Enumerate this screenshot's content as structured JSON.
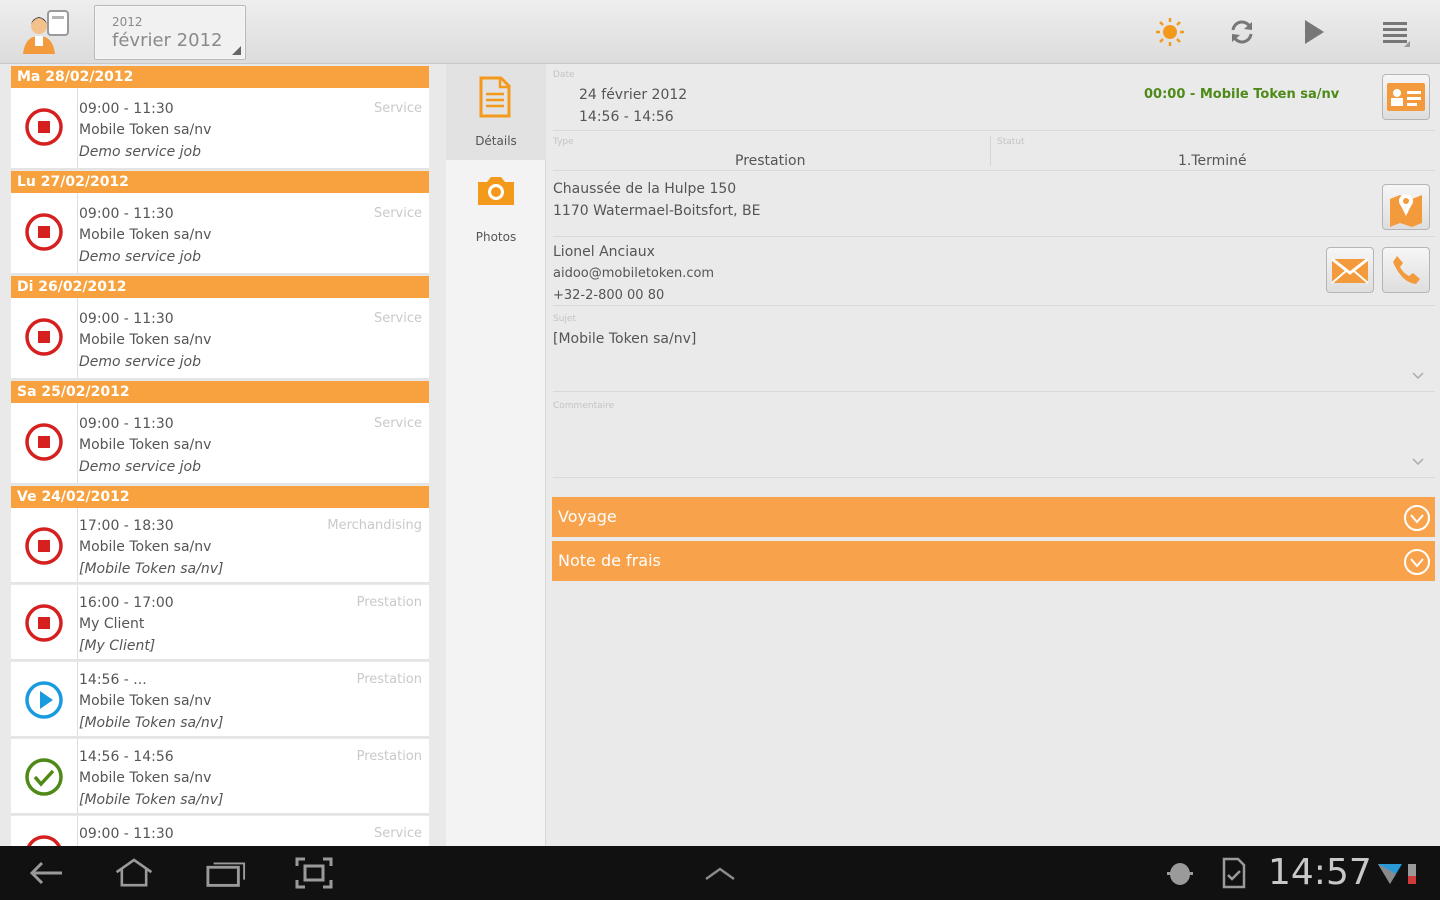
{
  "colors": {
    "accent": "#f8a23f",
    "stop": "#d62020",
    "running": "#1a9be0",
    "done": "#4f8a17"
  },
  "top_bar": {
    "month_spinner": {
      "year": "2012",
      "month": "février 2012"
    },
    "icons": [
      "sun-icon",
      "refresh-icon",
      "play-icon",
      "menu-icon"
    ]
  },
  "job_list": {
    "days": [
      {
        "header": "Ma 28/02/2012",
        "jobs": [
          {
            "status": "stopped",
            "time": "09:00 - 11:30",
            "client": "Mobile Token sa/nv",
            "desc": "Demo service job",
            "type": "Service"
          }
        ]
      },
      {
        "header": "Lu 27/02/2012",
        "jobs": [
          {
            "status": "stopped",
            "time": "09:00 - 11:30",
            "client": "Mobile Token sa/nv",
            "desc": "Demo service job",
            "type": "Service"
          }
        ]
      },
      {
        "header": "Di 26/02/2012",
        "jobs": [
          {
            "status": "stopped",
            "time": "09:00 - 11:30",
            "client": "Mobile Token sa/nv",
            "desc": "Demo service job",
            "type": "Service"
          }
        ]
      },
      {
        "header": "Sa 25/02/2012",
        "jobs": [
          {
            "status": "stopped",
            "time": "09:00 - 11:30",
            "client": "Mobile Token sa/nv",
            "desc": "Demo service job",
            "type": "Service"
          }
        ]
      },
      {
        "header": "Ve 24/02/2012",
        "jobs": [
          {
            "status": "stopped",
            "time": "17:00 - 18:30",
            "client": "Mobile Token sa/nv",
            "desc": "[Mobile Token sa/nv]",
            "type": "Merchandising"
          },
          {
            "status": "stopped",
            "time": "16:00 - 17:00",
            "client": "My Client",
            "desc": "[My Client]",
            "type": "Prestation"
          },
          {
            "status": "running",
            "time": "14:56 - ...",
            "client": "Mobile Token sa/nv",
            "desc": "[Mobile Token sa/nv]",
            "type": "Prestation"
          },
          {
            "status": "done",
            "time": "14:56 - 14:56",
            "client": "Mobile Token sa/nv",
            "desc": "[Mobile Token sa/nv]",
            "type": "Prestation"
          },
          {
            "status": "stopped",
            "time": "09:00 - 11:30",
            "client": "",
            "desc": "",
            "type": "Service"
          }
        ]
      }
    ]
  },
  "tabs": [
    {
      "label": "Détails",
      "icon": "document-icon"
    },
    {
      "label": "Photos",
      "icon": "camera-icon"
    }
  ],
  "detail": {
    "date_label": "Date",
    "date": "24 février 2012",
    "time_range": "14:56 - 14:56",
    "job_summary": "00:00 - Mobile Token sa/nv",
    "type_label": "Type",
    "type_value": "Prestation",
    "status_label": "Statut",
    "status_value": "1.Terminé",
    "address_line1": "Chaussée de la Hulpe 150",
    "address_line2": "1170 Watermael-Boitsfort, BE",
    "contact_name": "Lionel Anciaux",
    "contact_email": "aidoo@mobiletoken.com",
    "contact_phone": "+32-2-800 00 80",
    "subject_label": "Sujet",
    "subject_value": "[Mobile Token sa/nv]",
    "comment_label": "Commentaire",
    "sections": [
      "Voyage",
      "Note de frais"
    ]
  },
  "system_bar": {
    "clock": "14:57"
  }
}
